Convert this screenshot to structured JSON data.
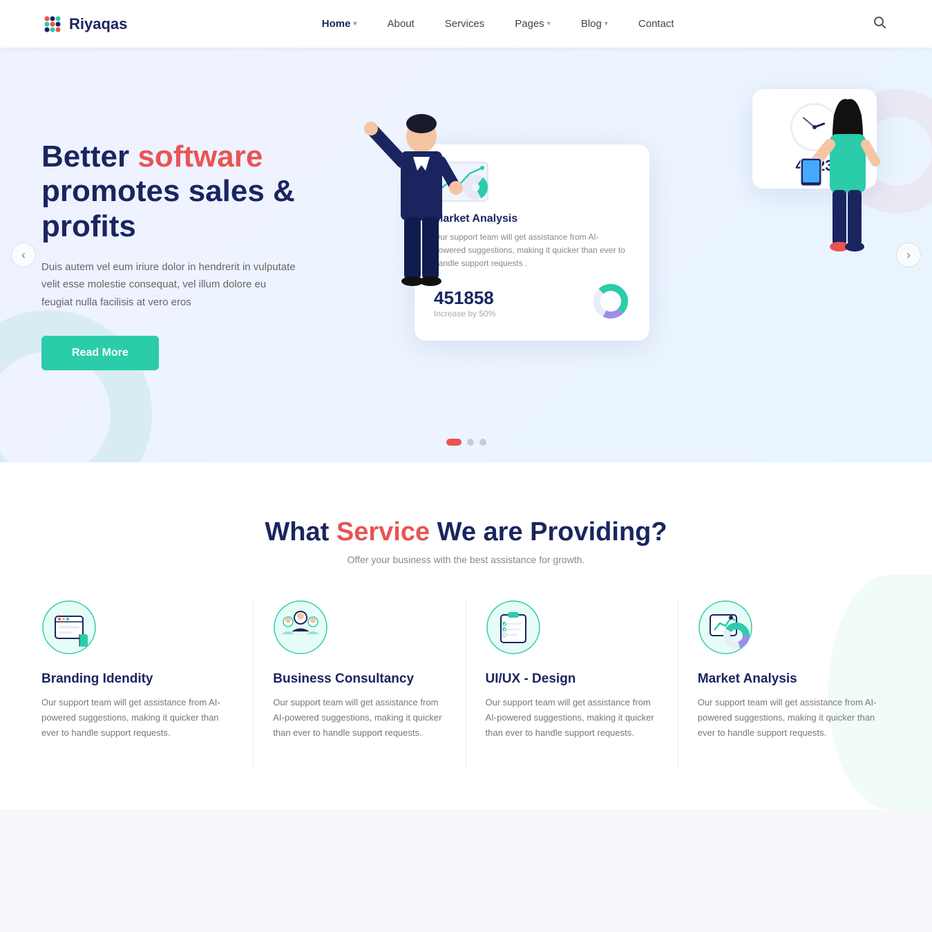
{
  "brand": {
    "name": "Riyaqas"
  },
  "nav": {
    "links": [
      {
        "label": "Home",
        "has_dropdown": true,
        "active": true
      },
      {
        "label": "About",
        "has_dropdown": false,
        "active": false
      },
      {
        "label": "Services",
        "has_dropdown": false,
        "active": false
      },
      {
        "label": "Pages",
        "has_dropdown": true,
        "active": false
      },
      {
        "label": "Blog",
        "has_dropdown": true,
        "active": false
      },
      {
        "label": "Contact",
        "has_dropdown": false,
        "active": false
      }
    ],
    "search_icon": "search"
  },
  "hero": {
    "title_part1": "Better ",
    "title_highlight": "software",
    "title_part2": " promotes sales & profits",
    "description": "Duis autem vel eum iriure dolor in hendrerit in vulputate velit esse molestie consequat, vel illum dolore eu feugiat nulla facilisis at vero eros",
    "cta_label": "Read More",
    "card_main": {
      "title": "Market Analysis",
      "description": "Our support team will get assistance from AI-powered suggestions, making it quicker than ever to handle support requests .",
      "stat": "451858",
      "stat_label": "Increase by 50%"
    },
    "card_top": {
      "stat": "45.23"
    },
    "slides": [
      {
        "active": true
      },
      {
        "active": false
      },
      {
        "active": false
      }
    ],
    "arrow_left": "‹",
    "arrow_right": "›"
  },
  "services": {
    "title_part1": "What ",
    "title_highlight": "Service",
    "title_part2": " We are Providing?",
    "subtitle": "Offer your business with the best assistance for growth.",
    "items": [
      {
        "icon": "branding",
        "name": "Branding Idendity",
        "description": "Our support team will get assistance from AI-powered suggestions, making it quicker than ever to handle support requests."
      },
      {
        "icon": "consultancy",
        "name": "Business Consultancy",
        "description": "Our support team will get assistance from AI-powered suggestions, making it quicker than ever to handle support requests."
      },
      {
        "icon": "uiux",
        "name": "UI/UX - Design",
        "description": "Our support team will get assistance from AI-powered suggestions, making it quicker than ever to handle support requests."
      },
      {
        "icon": "market",
        "name": "Market Analysis",
        "description": "Our support team will get assistance from AI-powered suggestions, making it quicker than ever to handle support requests."
      }
    ]
  }
}
